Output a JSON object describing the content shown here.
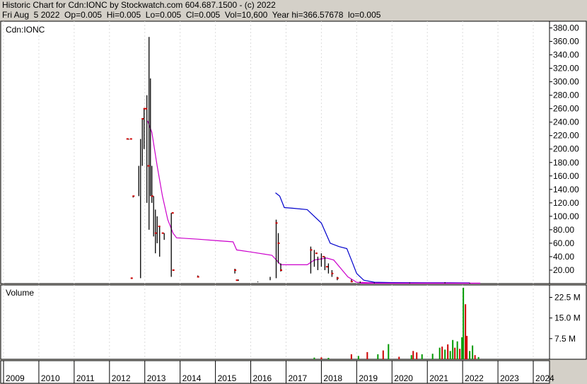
{
  "header": {
    "line1": "Historic Chart for Cdn:IONC by Stockwatch.com 604.687.1500 - (c) 2022",
    "line2": "Fri Aug  5 2022  Op=0.005  Hi=0.005  Lo=0.005  Cl=0.005  Vol=10,600  Year hi=366.57678  lo=0.005"
  },
  "colors": {
    "background": "#d4d0c8",
    "plot": "#ffffff",
    "price_bar": "#000000",
    "close_tick": "#cc0000",
    "ma_short": "#cc00cc",
    "ma_long": "#0000cc",
    "vol_up": "#009900",
    "vol_down": "#cc0000"
  },
  "chart_data": [
    {
      "type": "line",
      "symbol_label": "Cdn:IONC",
      "ylim": [
        0,
        390
      ],
      "y_ticks": [
        20,
        40,
        60,
        80,
        100,
        120,
        140,
        160,
        180,
        200,
        220,
        240,
        260,
        280,
        300,
        320,
        340,
        360,
        380
      ],
      "y_tick_labels": [
        "20.00",
        "40.00",
        "60.00",
        "80.00",
        "100.00",
        "120.00",
        "140.00",
        "160.00",
        "180.00",
        "200.00",
        "220.00",
        "240.00",
        "260.00",
        "280.00",
        "300.00",
        "320.00",
        "340.00",
        "360.00",
        "380.00"
      ],
      "x_years": [
        "2009",
        "2010",
        "2011",
        "2012",
        "2013",
        "2014",
        "2015",
        "2016",
        "2017",
        "2018",
        "2019",
        "2020",
        "2021",
        "2022",
        "2023",
        "2024"
      ],
      "price_bars": [
        {
          "t": 2012.55,
          "hi": 215,
          "lo": 214
        },
        {
          "t": 2012.67,
          "hi": 130,
          "lo": 128
        },
        {
          "t": 2012.62,
          "hi": 9,
          "lo": 7
        },
        {
          "t": 2012.83,
          "hi": 175,
          "lo": 130
        },
        {
          "t": 2012.88,
          "hi": 215,
          "lo": 8
        },
        {
          "t": 2012.93,
          "hi": 245,
          "lo": 175
        },
        {
          "t": 2012.98,
          "hi": 260,
          "lo": 200
        },
        {
          "t": 2013.06,
          "hi": 280,
          "lo": 120
        },
        {
          "t": 2013.12,
          "hi": 366.6,
          "lo": 80
        },
        {
          "t": 2013.16,
          "hi": 305,
          "lo": 130
        },
        {
          "t": 2013.2,
          "hi": 175,
          "lo": 120
        },
        {
          "t": 2013.25,
          "hi": 130,
          "lo": 70
        },
        {
          "t": 2013.3,
          "hi": 110,
          "lo": 45
        },
        {
          "t": 2013.35,
          "hi": 100,
          "lo": 60
        },
        {
          "t": 2013.42,
          "hi": 85,
          "lo": 40
        },
        {
          "t": 2013.55,
          "hi": 75,
          "lo": 65
        },
        {
          "t": 2013.75,
          "hi": 105,
          "lo": 10
        },
        {
          "t": 2014.5,
          "hi": 12,
          "lo": 10
        },
        {
          "t": 2015.55,
          "hi": 22,
          "lo": 15
        },
        {
          "t": 2015.65,
          "hi": 6,
          "lo": 4
        },
        {
          "t": 2016.2,
          "hi": 3,
          "lo": 2
        },
        {
          "t": 2016.55,
          "hi": 10,
          "lo": 5
        },
        {
          "t": 2016.72,
          "hi": 95,
          "lo": 8
        },
        {
          "t": 2016.78,
          "hi": 75,
          "lo": 30
        },
        {
          "t": 2016.85,
          "hi": 30,
          "lo": 18
        },
        {
          "t": 2017.7,
          "hi": 55,
          "lo": 15
        },
        {
          "t": 2017.8,
          "hi": 50,
          "lo": 25
        },
        {
          "t": 2017.9,
          "hi": 40,
          "lo": 20
        },
        {
          "t": 2018.0,
          "hi": 45,
          "lo": 25
        },
        {
          "t": 2018.1,
          "hi": 40,
          "lo": 20
        },
        {
          "t": 2018.2,
          "hi": 30,
          "lo": 15
        },
        {
          "t": 2018.3,
          "hi": 20,
          "lo": 10
        },
        {
          "t": 2018.45,
          "hi": 10,
          "lo": 5
        },
        {
          "t": 2018.85,
          "hi": 6,
          "lo": 2
        },
        {
          "t": 2019.1,
          "hi": 3,
          "lo": 1
        },
        {
          "t": 2019.5,
          "hi": 1.5,
          "lo": 0.5
        },
        {
          "t": 2020.5,
          "hi": 1.5,
          "lo": 0.5
        },
        {
          "t": 2021.5,
          "hi": 2,
          "lo": 0.5
        },
        {
          "t": 2022.2,
          "hi": 1,
          "lo": 0.005
        }
      ],
      "ma_short": [
        [
          2013.08,
          242
        ],
        [
          2013.2,
          225
        ],
        [
          2013.35,
          175
        ],
        [
          2013.5,
          130
        ],
        [
          2013.65,
          95
        ],
        [
          2013.8,
          75
        ],
        [
          2013.9,
          68
        ],
        [
          2014.5,
          66
        ],
        [
          2015.0,
          64
        ],
        [
          2015.5,
          62
        ],
        [
          2015.6,
          50
        ],
        [
          2016.0,
          47
        ],
        [
          2016.6,
          42
        ],
        [
          2016.85,
          28
        ],
        [
          2017.6,
          28
        ],
        [
          2017.8,
          35
        ],
        [
          2018.15,
          38
        ],
        [
          2018.35,
          35
        ],
        [
          2018.75,
          10
        ],
        [
          2019.0,
          2
        ],
        [
          2019.5,
          1
        ],
        [
          2020.5,
          1
        ],
        [
          2021.5,
          1
        ],
        [
          2022.2,
          0.8
        ]
      ],
      "ma_long": [
        [
          2016.7,
          135
        ],
        [
          2016.82,
          130
        ],
        [
          2016.95,
          113
        ],
        [
          2017.2,
          112
        ],
        [
          2017.6,
          110
        ],
        [
          2017.8,
          100
        ],
        [
          2018.0,
          90
        ],
        [
          2018.25,
          60
        ],
        [
          2018.5,
          55
        ],
        [
          2018.72,
          52
        ],
        [
          2018.85,
          35
        ],
        [
          2019.0,
          15
        ],
        [
          2019.2,
          5
        ],
        [
          2019.5,
          2
        ],
        [
          2020.0,
          1.5
        ],
        [
          2021.0,
          1.3
        ],
        [
          2022.2,
          1
        ]
      ],
      "close_ticks": [
        [
          2012.5,
          215
        ],
        [
          2012.6,
          215
        ],
        [
          2012.67,
          130
        ],
        [
          2012.62,
          8
        ],
        [
          2012.93,
          245
        ],
        [
          2012.98,
          260
        ],
        [
          2013.03,
          260
        ],
        [
          2013.1,
          175
        ],
        [
          2013.2,
          130
        ],
        [
          2013.3,
          75
        ],
        [
          2013.4,
          85
        ],
        [
          2013.5,
          75
        ],
        [
          2013.78,
          105
        ],
        [
          2013.8,
          20
        ],
        [
          2014.5,
          10
        ],
        [
          2015.55,
          20
        ],
        [
          2015.6,
          5
        ],
        [
          2016.72,
          90
        ],
        [
          2016.78,
          60
        ],
        [
          2016.85,
          20
        ],
        [
          2017.7,
          50
        ],
        [
          2017.85,
          45
        ],
        [
          2018.05,
          40
        ],
        [
          2018.15,
          25
        ],
        [
          2018.3,
          15
        ],
        [
          2018.45,
          8
        ],
        [
          2018.85,
          3
        ]
      ]
    },
    {
      "type": "bar",
      "title": "Volume",
      "ylim": [
        0,
        27000000
      ],
      "y_ticks": [
        7500000,
        15000000,
        22500000
      ],
      "y_tick_labels": [
        "7.5 M",
        "15.0 M",
        "22.5 M"
      ],
      "bars": [
        {
          "t": 2017.8,
          "v": 600000,
          "up": true
        },
        {
          "t": 2018.0,
          "v": 700000,
          "up": false
        },
        {
          "t": 2018.2,
          "v": 500000,
          "up": true
        },
        {
          "t": 2018.85,
          "v": 1800000,
          "up": false
        },
        {
          "t": 2019.05,
          "v": 1200000,
          "up": true
        },
        {
          "t": 2019.3,
          "v": 2600000,
          "up": false
        },
        {
          "t": 2019.6,
          "v": 1800000,
          "up": true
        },
        {
          "t": 2019.75,
          "v": 3200000,
          "up": false
        },
        {
          "t": 2019.9,
          "v": 5500000,
          "up": true
        },
        {
          "t": 2020.2,
          "v": 900000,
          "up": false
        },
        {
          "t": 2020.55,
          "v": 1500000,
          "up": true
        },
        {
          "t": 2020.6,
          "v": 3000000,
          "up": false
        },
        {
          "t": 2020.7,
          "v": 2500000,
          "up": false
        },
        {
          "t": 2020.85,
          "v": 1800000,
          "up": true
        },
        {
          "t": 2021.15,
          "v": 2000000,
          "up": true
        },
        {
          "t": 2021.35,
          "v": 4200000,
          "up": true
        },
        {
          "t": 2021.42,
          "v": 4600000,
          "up": false
        },
        {
          "t": 2021.5,
          "v": 3500000,
          "up": true
        },
        {
          "t": 2021.58,
          "v": 5400000,
          "up": false
        },
        {
          "t": 2021.65,
          "v": 3000000,
          "up": true
        },
        {
          "t": 2021.72,
          "v": 7000000,
          "up": true
        },
        {
          "t": 2021.78,
          "v": 4200000,
          "up": false
        },
        {
          "t": 2021.85,
          "v": 6500000,
          "up": true
        },
        {
          "t": 2021.92,
          "v": 3800000,
          "up": false
        },
        {
          "t": 2021.98,
          "v": 8000000,
          "up": true
        },
        {
          "t": 2022.02,
          "v": 26000000,
          "up": true
        },
        {
          "t": 2022.08,
          "v": 20000000,
          "up": false
        },
        {
          "t": 2022.12,
          "v": 8500000,
          "up": false
        },
        {
          "t": 2022.2,
          "v": 3000000,
          "up": true
        },
        {
          "t": 2022.28,
          "v": 5000000,
          "up": true
        },
        {
          "t": 2022.35,
          "v": 1500000,
          "up": false
        },
        {
          "t": 2022.45,
          "v": 800000,
          "up": true
        }
      ]
    }
  ]
}
